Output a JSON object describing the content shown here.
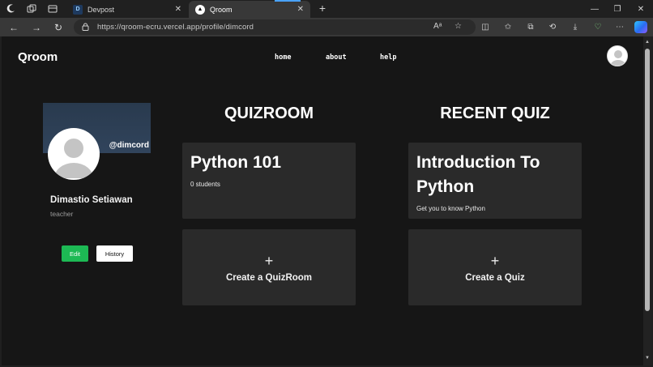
{
  "browser": {
    "tabs": [
      {
        "title": "Devpost",
        "favicon": "D"
      },
      {
        "title": "Qroom",
        "favicon": "▲"
      }
    ],
    "address": {
      "url": "https://qroom-ecru.vercel.app/profile/dimcord"
    }
  },
  "app": {
    "brand": "Qroom",
    "nav": [
      {
        "label": "home"
      },
      {
        "label": "about"
      },
      {
        "label": "help"
      }
    ]
  },
  "profile": {
    "handle": "@dimcord",
    "name": "Dimastio Setiawan",
    "role": "teacher",
    "edit_label": "Edit",
    "history_label": "History"
  },
  "quizroom": {
    "title": "QUIZROOM",
    "rooms": [
      {
        "name": "Python 101",
        "students": "0 students"
      }
    ],
    "create_label": "Create a QuizRoom"
  },
  "recent_quiz": {
    "title": "RECENT QUIZ",
    "quizzes": [
      {
        "name": "Introduction To Python",
        "description": "Get you to know Python"
      }
    ],
    "create_label": "Create a Quiz"
  },
  "colors": {
    "accent_green": "#1db954",
    "card_bg": "#2a2a2a",
    "page_bg": "#161616",
    "cover_bg": "#31445c"
  }
}
